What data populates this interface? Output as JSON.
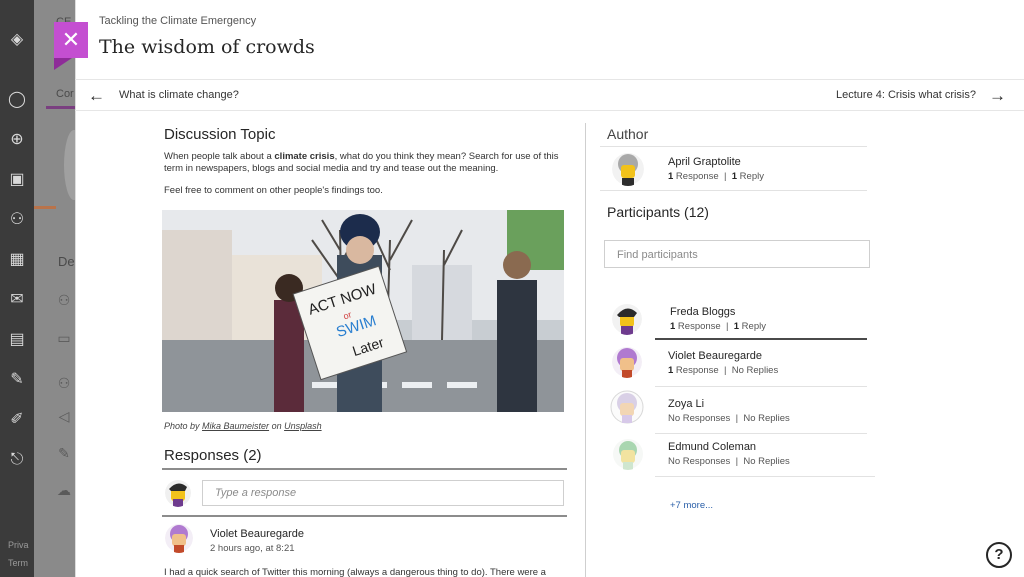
{
  "background": {
    "rail_icons": [
      "user-icon",
      "globe-icon",
      "courses-icon",
      "groups-icon",
      "calendar-icon",
      "mail-icon",
      "grades-icon",
      "tools-icon",
      "edit-icon",
      "logout-icon"
    ],
    "panel_partial_title": "CE",
    "tab_partial": "Cor",
    "section_partial": "De",
    "footer_privacy": "Priva",
    "footer_terms": "Term"
  },
  "header": {
    "course_title": "Tackling the Climate Emergency",
    "page_title": "The wisdom of crowds",
    "close_label": "✕"
  },
  "nav": {
    "prev_label": "What is climate change?",
    "next_label": "Lecture 4: Crisis what crisis?"
  },
  "discussion": {
    "heading": "Discussion Topic",
    "para1_pre": "When people talk about a ",
    "para1_bold": "climate crisis",
    "para1_post": ", what do you think they mean? Search for use of this term in newspapers, blogs and social media and try and tease out the meaning.",
    "para2": "Feel free to comment on other people's findings too.",
    "caption_pre": "Photo by ",
    "caption_author": "Mika Baumeister",
    "caption_mid": " on ",
    "caption_site": "Unsplash"
  },
  "responses": {
    "heading": "Responses (2)",
    "input_placeholder": "Type a response",
    "first": {
      "name": "Violet Beauregarde",
      "time": "2 hours ago, at 8:21",
      "text": "I had a quick search of Twitter this morning (always a dangerous thing to do). There were a"
    }
  },
  "author": {
    "heading": "Author",
    "name": "April Graptolite",
    "responses_count": "1",
    "responses_label": " Response",
    "replies_count": "1",
    "replies_label": " Reply"
  },
  "participants": {
    "heading": "Participants (12)",
    "search_placeholder": "Find participants",
    "list": [
      {
        "name": "Freda Bloggs",
        "count1": "1",
        "label1": " Response",
        "count2": "1",
        "label2": " Reply"
      },
      {
        "name": "Violet Beauregarde",
        "count1": "1",
        "label1": " Response",
        "count2": "",
        "label2": "No Replies"
      },
      {
        "name": "Zoya Li",
        "count1": "",
        "label1": "No Responses",
        "count2": "",
        "label2": "No Replies"
      },
      {
        "name": "Edmund Coleman",
        "count1": "",
        "label1": "No Responses",
        "count2": "",
        "label2": "No Replies"
      }
    ],
    "more_link": "+7 more..."
  },
  "help": {
    "label": "?"
  },
  "sign_text": {
    "line1": "ACT NOW",
    "line2": "or",
    "line3": "SWIM",
    "line4": "Later"
  },
  "colors": {
    "accent": "#c44fd1",
    "link": "#2a5fa8"
  }
}
